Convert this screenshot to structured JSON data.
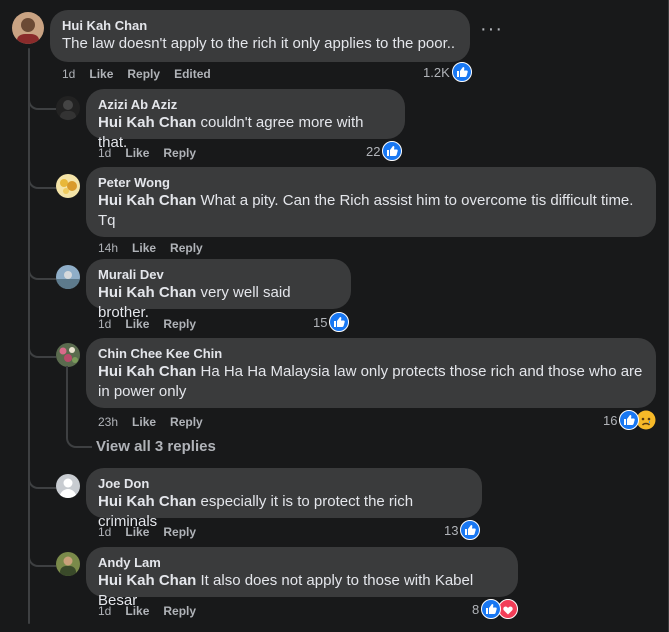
{
  "main_comment": {
    "author": "Hui Kah Chan",
    "text": "The law doesn't apply to the rich it only applies to the poor..",
    "time": "1d",
    "like": "Like",
    "reply": "Reply",
    "edited": "Edited",
    "reaction_count": "1.2K",
    "more": "···"
  },
  "replies": [
    {
      "author": "Azizi Ab Aziz",
      "mention": "Hui Kah Chan",
      "text": " couldn't agree more with that.",
      "time": "1d",
      "like": "Like",
      "reply": "Reply",
      "reaction_count": "22"
    },
    {
      "author": "Peter Wong",
      "mention": "Hui Kah Chan",
      "text": " What a pity. Can the Rich assist him to overcome tis difficult time. Tq",
      "time": "14h",
      "like": "Like",
      "reply": "Reply"
    },
    {
      "author": "Murali Dev",
      "mention": "Hui Kah Chan",
      "text": " very well said brother.",
      "time": "1d",
      "like": "Like",
      "reply": "Reply",
      "reaction_count": "15"
    },
    {
      "author": "Chin Chee Kee Chin",
      "mention": "Hui Kah Chan",
      "text": " Ha Ha Ha Malaysia law only protects those rich and those who are in power only",
      "time": "23h",
      "like": "Like",
      "reply": "Reply",
      "reaction_count": "16"
    },
    {
      "author": "Joe Don",
      "mention": "Hui Kah Chan",
      "text": " especially it is to protect the rich criminals",
      "time": "1d",
      "like": "Like",
      "reply": "Reply",
      "reaction_count": "13"
    },
    {
      "author": "Andy Lam",
      "mention": "Hui Kah Chan",
      "text": " It also does not apply to those with Kabel Besar",
      "time": "1d",
      "like": "Like",
      "reply": "Reply",
      "reaction_count": "8"
    }
  ],
  "view_replies": "View all 3 replies",
  "colors": {
    "background": "#18191a",
    "bubble": "#3a3b3c",
    "like_blue": "#1877f2",
    "love_red": "#f33e58",
    "sad_yellow": "#f7b928"
  }
}
